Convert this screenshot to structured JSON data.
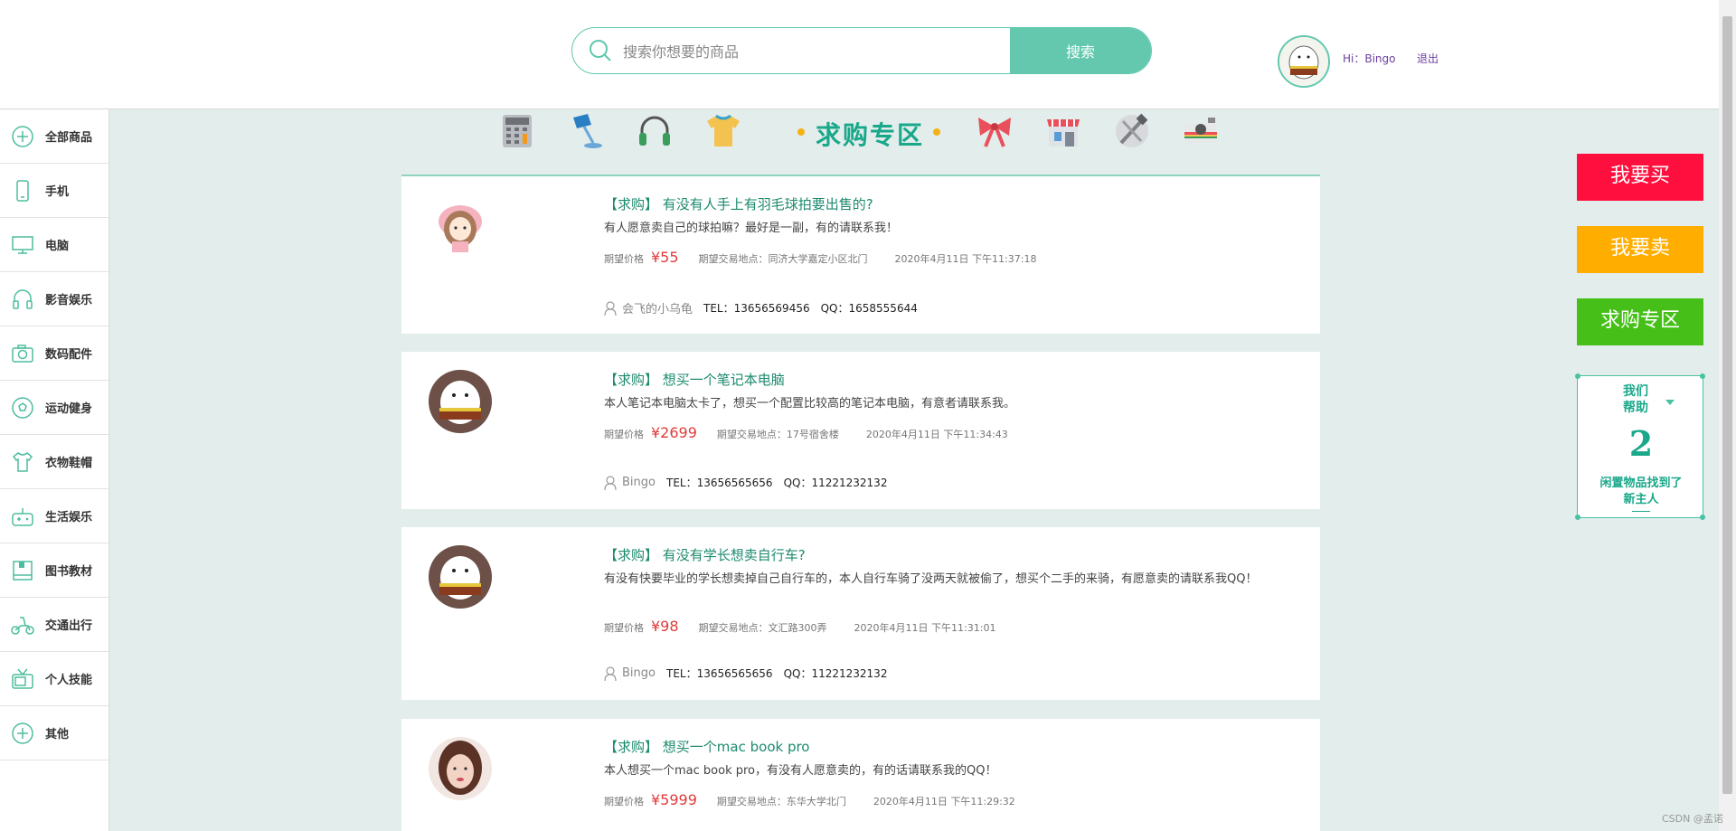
{
  "header": {
    "search_placeholder": "搜索你想要的商品",
    "search_button": "搜索",
    "greeting": "Hi：Bingo",
    "logout": "退出"
  },
  "sidebar": {
    "items": [
      {
        "label": "全部商品",
        "icon": "plus-circle-icon"
      },
      {
        "label": "手机",
        "icon": "phone-icon"
      },
      {
        "label": "电脑",
        "icon": "monitor-icon"
      },
      {
        "label": "影音娱乐",
        "icon": "headphones-icon"
      },
      {
        "label": "数码配件",
        "icon": "camera-icon"
      },
      {
        "label": "运动健身",
        "icon": "soccer-ball-icon"
      },
      {
        "label": "衣物鞋帽",
        "icon": "shirt-icon"
      },
      {
        "label": "生活娱乐",
        "icon": "gamepad-icon"
      },
      {
        "label": "图书教材",
        "icon": "book-icon"
      },
      {
        "label": "交通出行",
        "icon": "scooter-icon"
      },
      {
        "label": "个人技能",
        "icon": "tv-icon"
      },
      {
        "label": "其他",
        "icon": "plus-circle-icon"
      }
    ]
  },
  "category_bar": {
    "title": "求购专区",
    "icons": [
      "calculator-icon",
      "desk-lamp-icon",
      "headphones-icon",
      "tshirt-icon",
      "bow-icon",
      "store-icon",
      "tools-icon",
      "camera-icon"
    ]
  },
  "posts": [
    {
      "tag": "【求购】",
      "title": "有没有人手上有羽毛球拍要出售的?",
      "desc": "有人愿意卖自己的球拍嘛？最好是一副，有的请联系我！",
      "price_label": "期望价格",
      "price": "¥55",
      "loc_label": "期望交易地点：",
      "loc": "同济大学嘉定小区北门",
      "time": "2020年4月11日 下午11:37:18",
      "user": "会飞的小乌龟",
      "tel": "TEL：13656569456",
      "qq": "QQ：1658555644"
    },
    {
      "tag": "【求购】",
      "title": "想买一个笔记本电脑",
      "desc": "本人笔记本电脑太卡了，想买一个配置比较高的笔记本电脑，有意者请联系我。",
      "price_label": "期望价格",
      "price": "¥2699",
      "loc_label": "期望交易地点：",
      "loc": "17号宿舍楼",
      "time": "2020年4月11日 下午11:34:43",
      "user": "Bingo",
      "tel": "TEL：13656565656",
      "qq": "QQ：11221232132"
    },
    {
      "tag": "【求购】",
      "title": "有没有学长想卖自行车?",
      "desc": "有没有快要毕业的学长想卖掉自己自行车的，本人自行车骑了没两天就被偷了，想买个二手的来骑，有愿意卖的请联系我QQ！",
      "price_label": "期望价格",
      "price": "¥98",
      "loc_label": "期望交易地点：",
      "loc": "文汇路300弄",
      "time": "2020年4月11日 下午11:31:01",
      "user": "Bingo",
      "tel": "TEL：13656565656",
      "qq": "QQ：11221232132"
    },
    {
      "tag": "【求购】",
      "title": "想买一个mac book pro",
      "desc": "本人想买一个mac book pro，有没有人愿意卖的，有的话请联系我的QQ！",
      "price_label": "期望价格",
      "price": "¥5999",
      "loc_label": "期望交易地点：",
      "loc": "东华大学北门",
      "time": "2020年4月11日 下午11:29:32"
    }
  ],
  "right_panel": {
    "buy_button": "我要买",
    "sell_button": "我要卖",
    "wanted_button": "求购专区",
    "buy_color": "#ff0f3e",
    "sell_color": "#ffae00",
    "wanted_color": "#46c018",
    "help_head_1": "我们",
    "help_head_2": "帮助",
    "help_count": "2",
    "help_foot_1": "闲置物品找到了",
    "help_foot_2": "新主人"
  },
  "watermark": "CSDN @孟诺"
}
